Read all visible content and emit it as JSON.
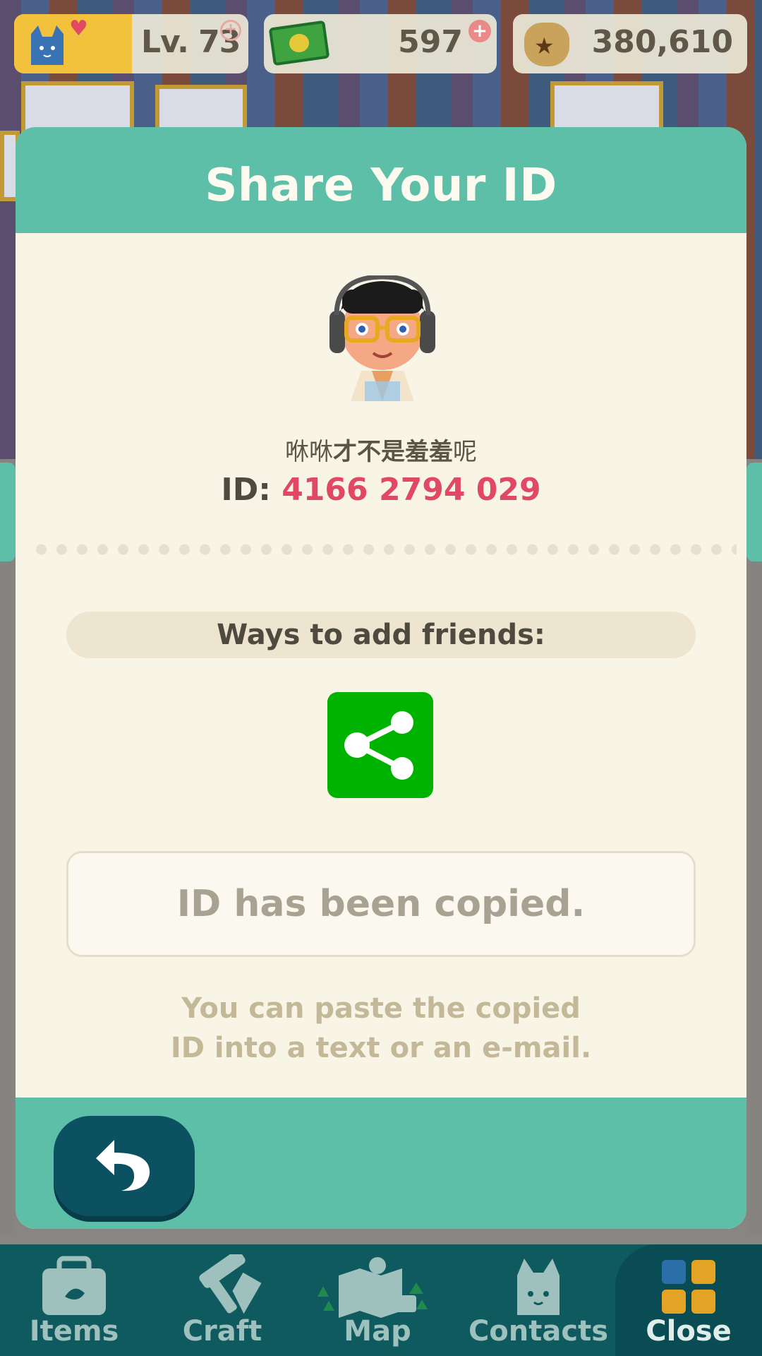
{
  "hud": {
    "level_label": "Lv. 73",
    "tickets": "597",
    "bells": "380,610"
  },
  "modal": {
    "title": "Share Your ID",
    "player_name_plain": "咻咻",
    "player_name_bold": "才不是羞羞",
    "player_name_end": "呢",
    "id_prefix": "ID: ",
    "id_value": "4166 2794 029",
    "ways_label": "Ways to add friends:",
    "copied_message": "ID has been copied.",
    "hint_line1": "You can paste the copied",
    "hint_line2": "ID into a text or an e-mail."
  },
  "nav": {
    "items": [
      {
        "label": "Items",
        "icon": "bag-icon"
      },
      {
        "label": "Craft",
        "icon": "hammer-saw-icon"
      },
      {
        "label": "Map",
        "icon": "map-icon"
      },
      {
        "label": "Contacts",
        "icon": "cat-face-icon"
      },
      {
        "label": "Close",
        "icon": "grid-icon"
      }
    ]
  },
  "colors": {
    "teal": "#5dbfa7",
    "cream": "#f8f5e6",
    "id_red": "#e04864",
    "share_green": "#00b300",
    "back_button": "#0c5161",
    "nav_bg": "#0f5a5e"
  }
}
